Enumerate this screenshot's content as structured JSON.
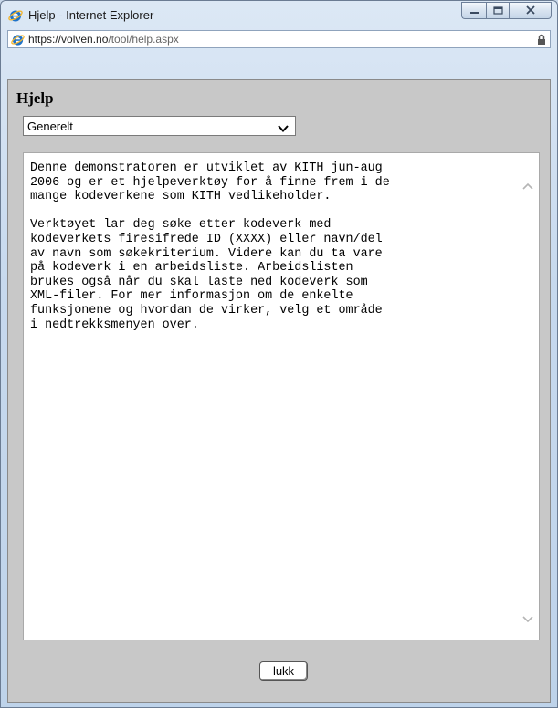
{
  "window": {
    "title": "Hjelp - Internet Explorer"
  },
  "address_bar": {
    "url_host": "https://volven.no",
    "url_path": "/tool/help.aspx"
  },
  "page": {
    "heading": "Hjelp",
    "topic_select": {
      "selected": "Generelt"
    },
    "help_text": "Denne demonstratoren er utviklet av KITH jun-aug\n2006 og er et hjelpeverktøy for å finne frem i de\nmange kodeverkene som KITH vedlikeholder.\n\nVerktøyet lar deg søke etter kodeverk med\nkodeverkets firesifrede ID (XXXX) eller navn/del\nav navn som søkekriterium. Videre kan du ta vare\npå kodeverk i en arbeidsliste. Arbeidslisten\nbrukes også når du skal laste ned kodeverk som\nXML-filer. For mer informasjon om de enkelte\nfunksjonene og hvordan de virker, velg et område\ni nedtrekksmenyen over.",
    "close_button_label": "lukk"
  },
  "icons": {
    "window_icon": "ie-logo-icon",
    "url_icon": "ie-logo-icon",
    "security": "lock-icon",
    "minimize": "minimize-icon",
    "maximize": "maximize-icon",
    "close": "close-icon",
    "dropdown": "chevron-down-icon"
  },
  "colors": {
    "ie_blue": "#1e72c8",
    "ie_ring": "#f2b632",
    "content_bg": "#c8c8c8",
    "frame": "#c7d9ee"
  }
}
